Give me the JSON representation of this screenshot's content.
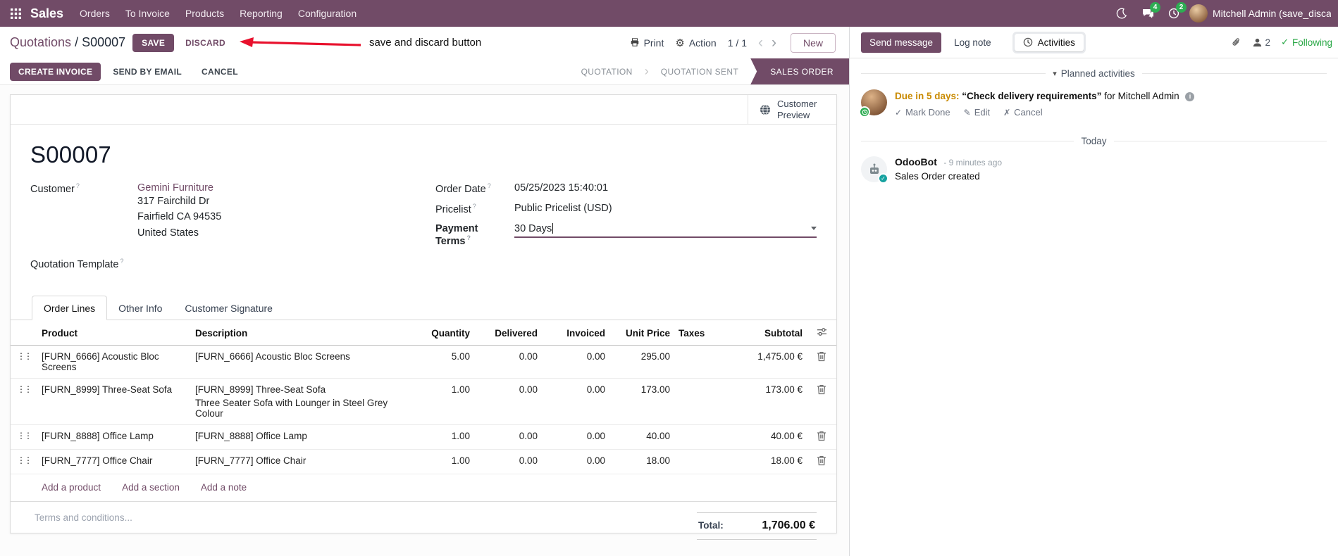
{
  "colors": {
    "accent": "#714B67",
    "highlight_blue": "#2e7cd6",
    "success_green": "#28a745",
    "badge_green": "#2ead53",
    "due_orange": "#c98a00",
    "annotation_red": "#e8112d"
  },
  "nav": {
    "app_label": "Sales",
    "menus": [
      "Orders",
      "To Invoice",
      "Products",
      "Reporting",
      "Configuration"
    ],
    "messages_badge": "4",
    "activities_badge": "2",
    "user_name": "Mitchell Admin (save_discar"
  },
  "cp": {
    "breadcrumb_parent": "Quotations",
    "breadcrumb_sep": "/",
    "breadcrumb_current": "S00007",
    "save": "SAVE",
    "discard": "DISCARD",
    "annotation": "save and discard button",
    "print": "Print",
    "action": "Action",
    "pager": "1 / 1",
    "new": "New"
  },
  "sb": {
    "create_invoice": "CREATE INVOICE",
    "send_by_email": "SEND BY EMAIL",
    "cancel": "CANCEL",
    "states": [
      "QUOTATION",
      "QUOTATION SENT",
      "SALES ORDER"
    ],
    "active_state": "SALES ORDER"
  },
  "form": {
    "customer_preview": "Customer Preview",
    "title": "S00007",
    "hint": "?",
    "labels": {
      "customer": "Customer",
      "quotation_template": "Quotation Template",
      "order_date": "Order Date",
      "pricelist": "Pricelist",
      "payment_terms": "Payment Terms"
    },
    "customer": {
      "name": "Gemini Furniture",
      "address1": "317 Fairchild Dr",
      "address2": "Fairfield CA 94535",
      "address3": "United States"
    },
    "values": {
      "order_date": "05/25/2023 15:40:01",
      "pricelist": "Public Pricelist (USD)",
      "payment_terms": "30 Days"
    },
    "tabs": [
      "Order Lines",
      "Other Info",
      "Customer Signature"
    ],
    "table": {
      "headers": [
        "Product",
        "Description",
        "Quantity",
        "Delivered",
        "Invoiced",
        "Unit Price",
        "Taxes",
        "Subtotal"
      ],
      "rows": [
        {
          "product": "[FURN_6666] Acoustic Bloc Screens",
          "description": "[FURN_6666] Acoustic Bloc Screens",
          "quantity": "5.00",
          "delivered": "0.00",
          "invoiced": "0.00",
          "unit_price": "295.00",
          "taxes": "",
          "subtotal": "1,475.00 €"
        },
        {
          "product": "[FURN_8999] Three-Seat Sofa",
          "description": "[FURN_8999] Three-Seat Sofa",
          "description2": "Three Seater Sofa with Lounger in Steel Grey Colour",
          "quantity": "1.00",
          "delivered": "0.00",
          "invoiced": "0.00",
          "unit_price": "173.00",
          "taxes": "",
          "subtotal": "173.00 €"
        },
        {
          "product": "[FURN_8888] Office Lamp",
          "description": "[FURN_8888] Office Lamp",
          "quantity": "1.00",
          "delivered": "0.00",
          "invoiced": "0.00",
          "unit_price": "40.00",
          "taxes": "",
          "subtotal": "40.00 €"
        },
        {
          "product": "[FURN_7777] Office Chair",
          "description": "[FURN_7777] Office Chair",
          "quantity": "1.00",
          "delivered": "0.00",
          "invoiced": "0.00",
          "unit_price": "18.00",
          "taxes": "",
          "subtotal": "18.00 €"
        }
      ]
    },
    "add_product": "Add a product",
    "add_section": "Add a section",
    "add_note": "Add a note",
    "terms_placeholder": "Terms and conditions...",
    "total_label": "Total:",
    "total_value": "1,706.00 €"
  },
  "chatter": {
    "send_message": "Send message",
    "log_note": "Log note",
    "activities": "Activities",
    "followers_count": "2",
    "following": "Following",
    "planned_label": "Planned activities",
    "activity": {
      "due": "Due in 5 days:",
      "summary": "“Check delivery requirements”",
      "for_user": "for Mitchell Admin",
      "mark_done": "Mark Done",
      "edit": "Edit",
      "cancel": "Cancel"
    },
    "today": "Today",
    "message": {
      "author": "OdooBot",
      "time": "- 9 minutes ago",
      "body": "Sales Order created"
    }
  }
}
